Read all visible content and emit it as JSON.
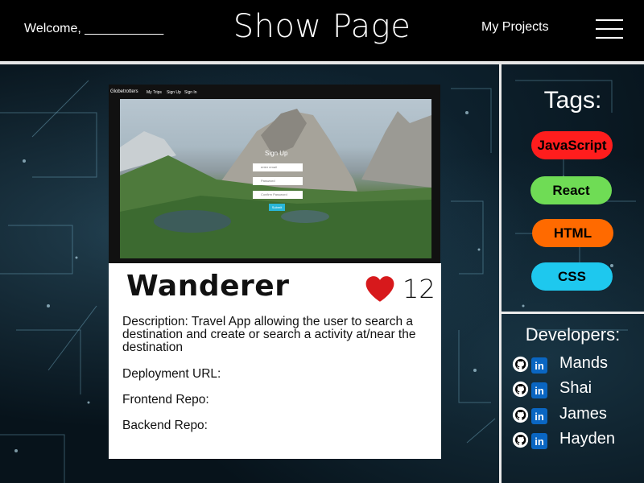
{
  "header": {
    "welcome": "Welcome, ___________",
    "title": "Show Page",
    "my_projects": "My Projects"
  },
  "screenshot": {
    "brand": "Globetrotters",
    "nav": [
      "My Trips",
      "Sign Up",
      "Sign In"
    ],
    "form_title": "Sign Up",
    "inputs": [
      "enter email",
      "Password",
      "Confirm Password"
    ],
    "submit": "Submit"
  },
  "project": {
    "name": "Wanderer",
    "likes": "12",
    "description": "Description: Travel App allowing the user to search a destination and create or search a activity at/near the destination",
    "deployment": "Deployment URL:",
    "frontend": "Frontend Repo:",
    "backend": "Backend Repo:"
  },
  "tags": {
    "title": "Tags:",
    "items": [
      {
        "label": "JavaScript",
        "color": "#ff1d1d"
      },
      {
        "label": "React",
        "color": "#6fdc55"
      },
      {
        "label": "HTML",
        "color": "#ff6a00"
      },
      {
        "label": "CSS",
        "color": "#1ec8ee"
      }
    ]
  },
  "developers": {
    "title": "Developers:",
    "items": [
      {
        "name": "Mands",
        "icons": [
          "github-icon",
          "linkedin-icon"
        ]
      },
      {
        "name": "Shai",
        "icons": [
          "github-icon",
          "linkedin-icon"
        ]
      },
      {
        "name": "James",
        "icons": [
          "github-icon",
          "linkedin-icon"
        ]
      },
      {
        "name": "Hayden",
        "icons": [
          "github-icon",
          "linkedin-icon"
        ]
      }
    ]
  },
  "colors": {
    "header_bg": "#000000",
    "heart": "#d7191c",
    "linkedin": "#0a66c2",
    "divider": "#eaeaea"
  }
}
